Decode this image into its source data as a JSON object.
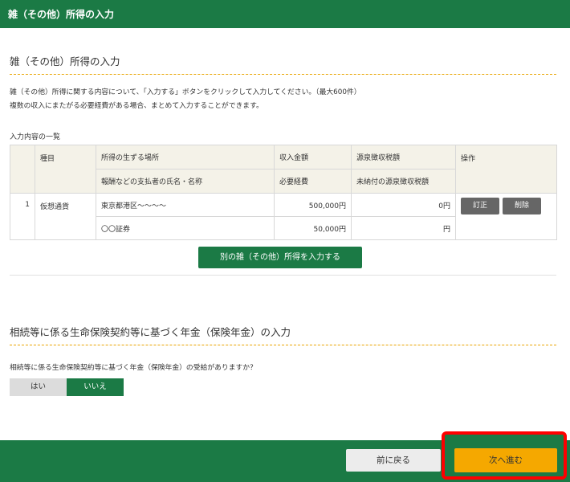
{
  "header": {
    "title": "雑（その他）所得の入力"
  },
  "section1": {
    "title": "雑（その他）所得の入力",
    "description_line1": "雑（その他）所得に関する内容について、「入力する」ボタンをクリックして入力してください。（最大600件）",
    "description_line2": "複数の収入にまたがる必要経費がある場合、まとめて入力することができます。",
    "list_caption": "入力内容の一覧",
    "table": {
      "headers": {
        "kind": "種目",
        "place": "所得の生ずる場所",
        "payer": "報酬などの支払者の氏名・名称",
        "income": "収入金額",
        "expense": "必要経費",
        "withholding": "源泉徴収税額",
        "unpaid_withholding": "未納付の源泉徴収税額",
        "ops": "操作"
      },
      "rows": [
        {
          "index": "1",
          "kind": "仮想通貨",
          "place": "東京都港区～～～～",
          "payer": "〇〇証券",
          "income": "500,000円",
          "expense": "50,000円",
          "withholding": "0円",
          "unpaid_withholding": "円",
          "edit_label": "訂正",
          "delete_label": "削除"
        }
      ]
    },
    "add_button": "別の雑（その他）所得を入力する"
  },
  "section2": {
    "title": "相続等に係る生命保険契約等に基づく年金（保険年金）の入力",
    "question": "相続等に係る生命保険契約等に基づく年金（保険年金）の受給がありますか？",
    "yes_label": "はい",
    "no_label": "いいえ",
    "selected": "いいえ"
  },
  "footer": {
    "back_label": "前に戻る",
    "next_label": "次へ進む",
    "highlight_color": "#ff0000"
  },
  "colors": {
    "brand_green": "#1b7a45",
    "accent_orange": "#f5a800"
  }
}
